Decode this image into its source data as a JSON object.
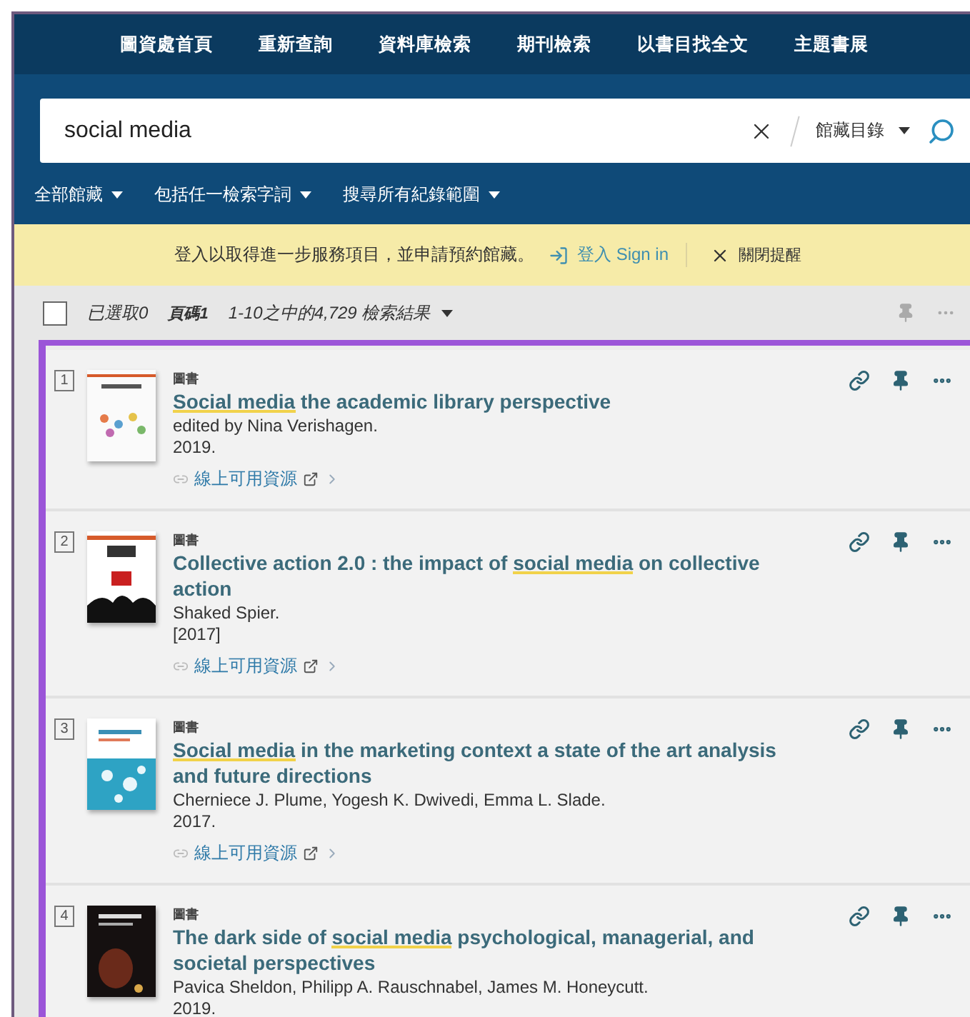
{
  "nav": [
    "圖資處首頁",
    "重新查詢",
    "資料庫檢索",
    "期刊檢索",
    "以書目找全文",
    "主題書展"
  ],
  "search": {
    "value": "social media",
    "scope": "館藏目錄"
  },
  "filters": [
    "全部館藏",
    "包括任一檢索字詞",
    "搜尋所有紀錄範圍"
  ],
  "banner": {
    "message": "登入以取得進一步服務項目，並申請預約館藏。",
    "sign_in": "登入 Sign in",
    "dismiss": "關閉提醒"
  },
  "results_header": {
    "checked": false,
    "selected_count": "已選取0",
    "page": "頁碼1",
    "summary": "1-10之中的4,729 檢索結果"
  },
  "results": [
    {
      "number": "1",
      "type": "圖書",
      "title": [
        {
          "text": "Social media",
          "highlight": true
        },
        {
          "text": " the academic library perspective",
          "highlight": false
        }
      ],
      "authors": "edited by Nina Verishagen.",
      "year": "2019.",
      "online": "線上可用資源"
    },
    {
      "number": "2",
      "type": "圖書",
      "title": [
        {
          "text": "Collective action 2.0 : the impact of ",
          "highlight": false
        },
        {
          "text": "social media",
          "highlight": true
        },
        {
          "text": " on collective action",
          "highlight": false
        }
      ],
      "authors": "Shaked Spier.",
      "year": "[2017]",
      "online": "線上可用資源"
    },
    {
      "number": "3",
      "type": "圖書",
      "title": [
        {
          "text": "Social media",
          "highlight": true
        },
        {
          "text": " in the marketing context a state of the art analysis and future directions",
          "highlight": false
        }
      ],
      "authors": "Cherniece J. Plume, Yogesh K. Dwivedi, Emma L. Slade.",
      "year": "2017.",
      "online": "線上可用資源"
    },
    {
      "number": "4",
      "type": "圖書",
      "title": [
        {
          "text": "The dark side of ",
          "highlight": false
        },
        {
          "text": "social media",
          "highlight": true
        },
        {
          "text": " psychological, managerial, and societal perspectives",
          "highlight": false
        }
      ],
      "authors": "Pavica Sheldon, Philipp A. Rauschnabel, James M. Honeycutt.",
      "year": "2019."
    }
  ]
}
